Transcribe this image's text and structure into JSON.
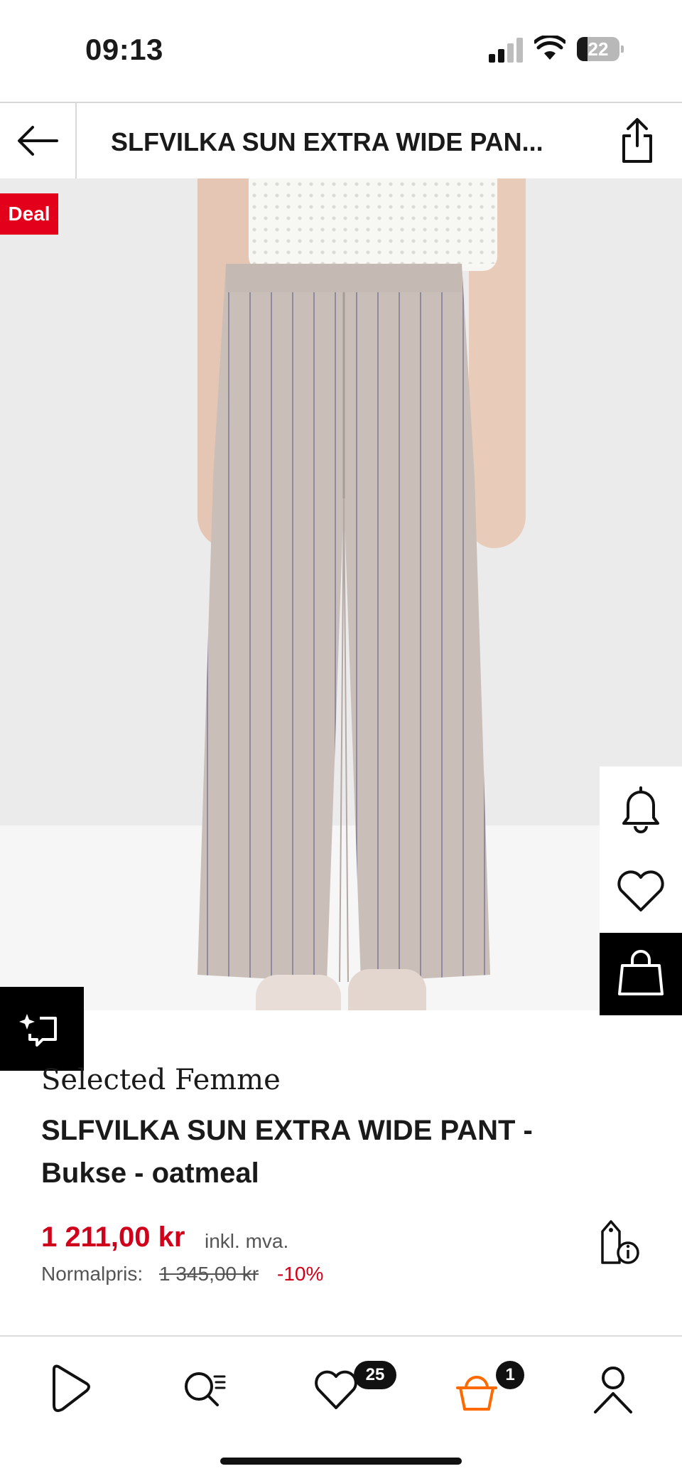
{
  "status_bar": {
    "time": "09:13",
    "battery": "22"
  },
  "header": {
    "title": "SLFVILKA SUN EXTRA WIDE PAN...",
    "back_icon": "arrow-left-icon",
    "share_icon": "share-icon"
  },
  "product_image": {
    "deal_badge": "Deal"
  },
  "side_actions": {
    "notify_icon": "bell-icon",
    "wishlist_icon": "heart-icon",
    "bag_icon": "shopping-bag-icon",
    "ai_icon": "sparkle-chat-icon"
  },
  "product": {
    "brand": "Selected Femme",
    "name": "SLFVILKA SUN EXTRA WIDE PANT - Bukse - oatmeal",
    "price": "1 211,00 kr",
    "vat_note": "inkl. mva.",
    "normal_label": "Normalpris:",
    "normal_price": "1 345,00 kr",
    "discount": "-10%",
    "price_info_icon": "price-tag-info-icon"
  },
  "bottom_nav": {
    "items": [
      {
        "icon": "home-play-icon"
      },
      {
        "icon": "search-list-icon"
      },
      {
        "icon": "heart-icon",
        "badge": "25"
      },
      {
        "icon": "basket-icon",
        "badge": "1"
      },
      {
        "icon": "profile-icon"
      }
    ]
  },
  "colors": {
    "accent_red": "#e2001a",
    "price_red": "#d0021b",
    "basket_orange": "#ff6a00"
  }
}
